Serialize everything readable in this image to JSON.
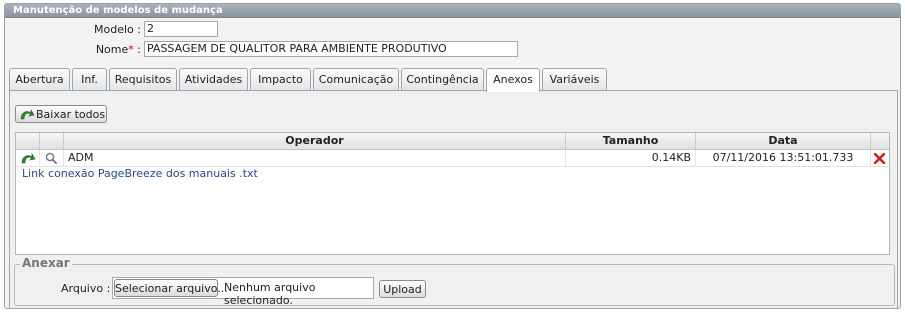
{
  "panel": {
    "title": "Manutenção de modelos de mudança"
  },
  "form": {
    "modelo_label": "Modelo :",
    "modelo_value": "2",
    "nome_label": "Nome",
    "nome_required": "*",
    "nome_colon": ":",
    "nome_value": "PASSAGEM DE QUALITOR PARA AMBIENTE PRODUTIVO"
  },
  "tabs": [
    {
      "label": "Abertura"
    },
    {
      "label": "Inf."
    },
    {
      "label": "Requisitos"
    },
    {
      "label": "Atividades"
    },
    {
      "label": "Impacto"
    },
    {
      "label": "Comunicação"
    },
    {
      "label": "Contingência"
    },
    {
      "label": "Anexos",
      "active": true
    },
    {
      "label": "Variáveis"
    }
  ],
  "anexos": {
    "download_all_label": "Baixar todos",
    "grid": {
      "columns": [
        "Operador",
        "Tamanho",
        "Data"
      ],
      "rows": [
        {
          "operador": "ADM",
          "tamanho": "0.14KB",
          "data": "07/11/2016 13:51:01.733",
          "file": "Link conexão PageBreeze dos manuais .txt"
        }
      ]
    },
    "anexar": {
      "legend": "Anexar",
      "arquivo_label": "Arquivo :",
      "select_button": "Selecionar arquivo...",
      "no_file_text": "Nenhum arquivo selecionado.",
      "upload_button": "Upload"
    }
  },
  "colors": {
    "header": "#8c959f",
    "link": "#1e4c8f",
    "required": "#d40000",
    "delete": "#d42020",
    "download": "#2f8a2f"
  }
}
